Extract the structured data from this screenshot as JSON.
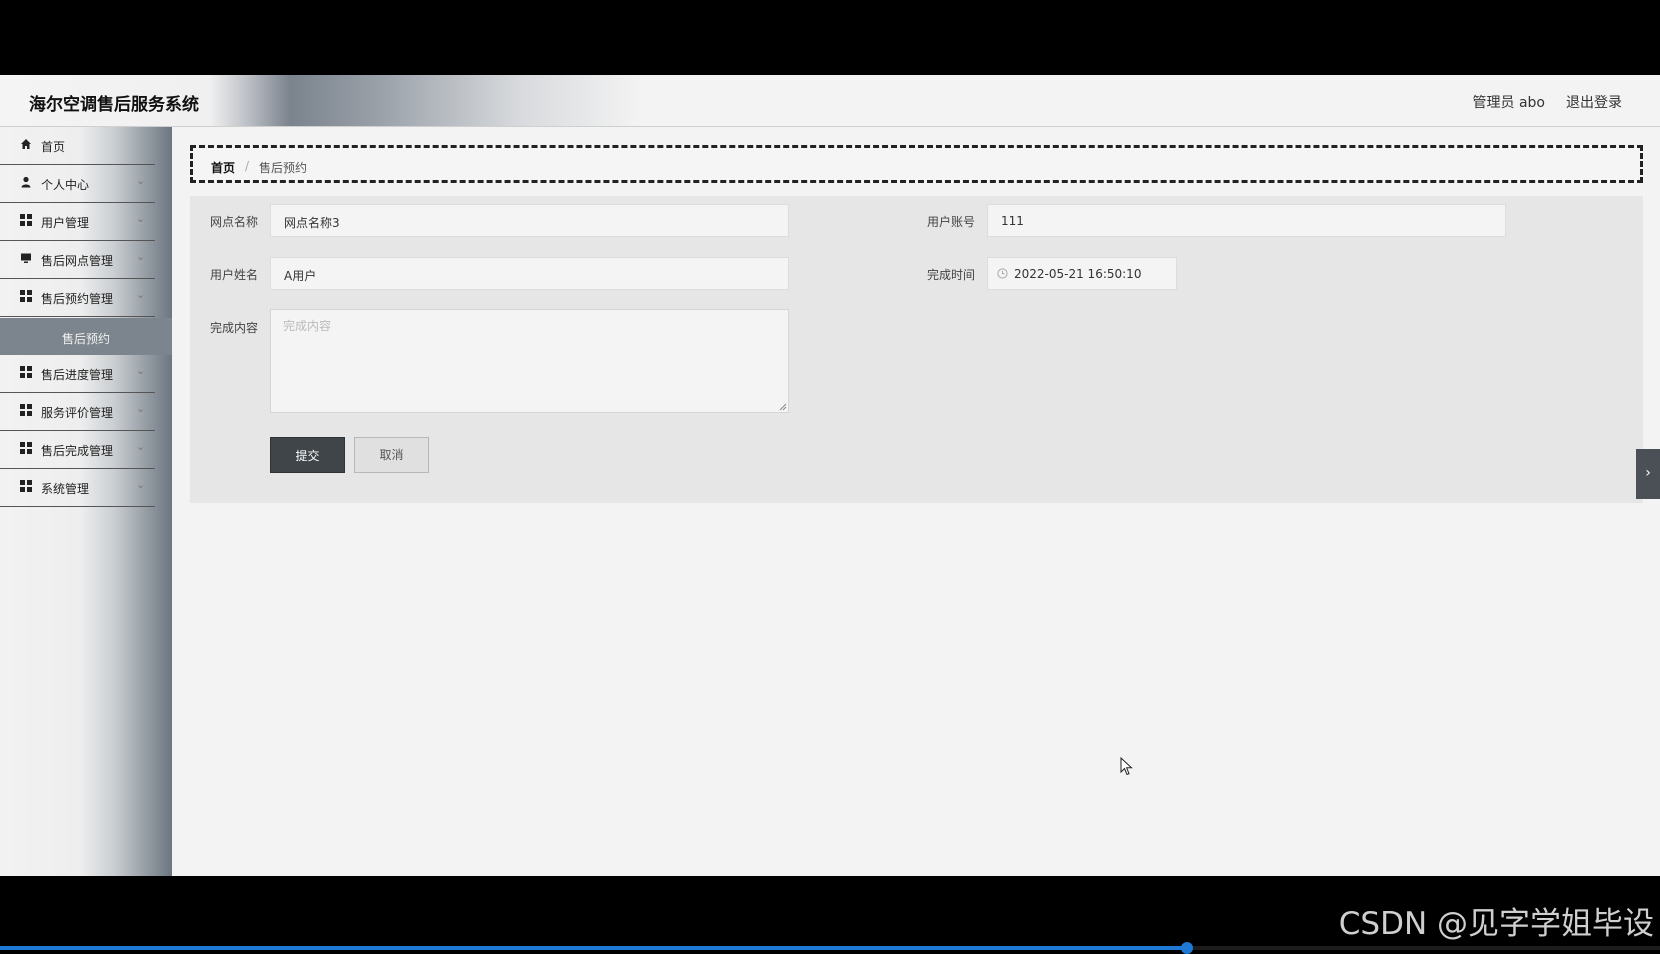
{
  "header": {
    "title": "海尔空调售后服务系统",
    "user": "管理员 abo",
    "logout": "退出登录"
  },
  "sidebar": {
    "items": [
      {
        "label": "首页",
        "icon": "home-icon",
        "has_children": false
      },
      {
        "label": "个人中心",
        "icon": "user-icon",
        "has_children": true
      },
      {
        "label": "用户管理",
        "icon": "grid-icon",
        "has_children": true
      },
      {
        "label": "售后网点管理",
        "icon": "monitor-icon",
        "has_children": true
      },
      {
        "label": "售后预约管理",
        "icon": "grid-icon",
        "has_children": true
      },
      {
        "label": "售后进度管理",
        "icon": "grid-icon",
        "has_children": true
      },
      {
        "label": "服务评价管理",
        "icon": "grid-icon",
        "has_children": true
      },
      {
        "label": "售后完成管理",
        "icon": "grid-icon",
        "has_children": true
      },
      {
        "label": "系统管理",
        "icon": "grid-icon",
        "has_children": true
      }
    ],
    "active_sub": "售后预约"
  },
  "breadcrumb": {
    "home": "首页",
    "separator": "/",
    "current": "售后预约"
  },
  "form": {
    "outlet_name": {
      "label": "网点名称",
      "value": "网点名称3"
    },
    "user_account": {
      "label": "用户账号",
      "value": "111"
    },
    "user_name": {
      "label": "用户姓名",
      "value": "A用户"
    },
    "finish_time": {
      "label": "完成时间",
      "value": "2022-05-21 16:50:10"
    },
    "finish_content": {
      "label": "完成内容",
      "placeholder": "完成内容"
    },
    "submit": "提交",
    "cancel": "取消"
  },
  "watermark": "CSDN @见字学姐毕设",
  "video_progress": 0.715,
  "colors": {
    "accent": "#1f7ad6",
    "submit_bg": "#3f4549"
  }
}
